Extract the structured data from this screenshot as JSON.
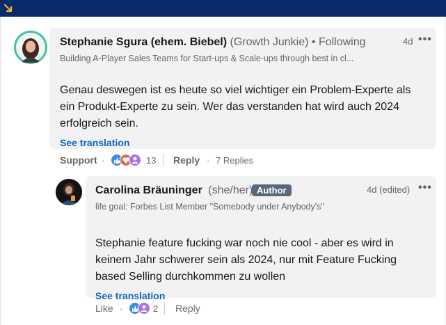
{
  "colors": {
    "topbar": "#0a2b6b",
    "accent_arrow": "#f5b042",
    "link": "#0a66c2",
    "author_badge": "#56687a",
    "bubble": "#f2f2f2",
    "like_blue": "#378fe9",
    "love_red": "#df704d",
    "support_purple": "#a872e8"
  },
  "comment": {
    "author": "Stephanie Sgura (ehem. Biebel)",
    "pronouns": "(Growth Junkie)",
    "connection": "• Following",
    "headline": "Building A-Player Sales Teams for Start-ups & Scale-ups through best in cl...",
    "time": "4d",
    "more_icon": "more-horizontal-icon",
    "text": "Genau deswegen ist es heute so viel wichtiger ein Problem-Experte als ein Produkt-Experte zu sein. Wer das verstanden hat wird auch 2024 erfolgreich sein.",
    "see_translation": "See translation",
    "actions": {
      "reaction_label": "Support",
      "reaction_count": "13",
      "reply_label": "Reply",
      "replies": "7 Replies"
    }
  },
  "reply": {
    "author": "Carolina Bräuninger",
    "pronouns": "(she/her)",
    "badge": "Author",
    "headline": "life goal: Forbes List Member \"Somebody under Anybody's\"",
    "time": "4d (edited)",
    "text": "Stephanie feature fucking war noch nie cool - aber es wird in keinem Jahr schwerer sein als 2024, nur mit Feature Fucking based Selling durchkommen zu wollen",
    "see_translation": "See translation",
    "actions": {
      "like_label": "Like",
      "reaction_count": "2",
      "reply_label": "Reply"
    }
  }
}
